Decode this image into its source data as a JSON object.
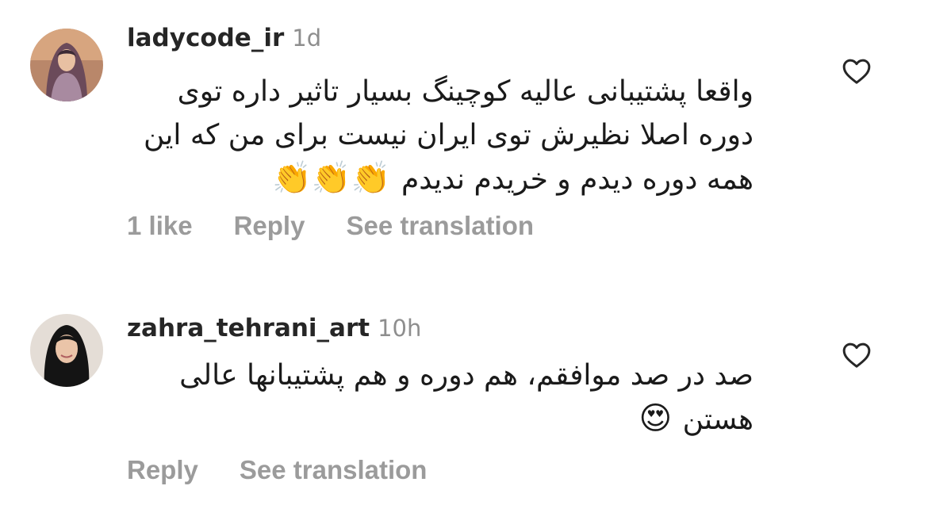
{
  "comments": [
    {
      "username": "ladycode_ir",
      "time": "1d",
      "text_lines": [
        "واقعا پشتیبانی عالیه کوچینگ بسیار تاثیر داره توی",
        "دوره  اصلا نظیرش توی ایران نیست برای من که این",
        "همه دوره دیدم و خریدم ندیدم"
      ],
      "emoji": "👏👏👏",
      "likes": "1 like",
      "reply": "Reply",
      "translate": "See translation",
      "avatar_icon": "woman-in-hijab-avatar",
      "heart_icon": "heart-outline-icon"
    },
    {
      "username": "zahra_tehrani_art",
      "time": "10h",
      "text_lines": [
        "صد در صد موافقم، هم دوره و هم پشتیبانها عالی",
        "هستن"
      ],
      "emoji": "😍",
      "reply": "Reply",
      "translate": "See translation",
      "avatar_icon": "woman-in-black-hijab-avatar",
      "heart_icon": "heart-outline-icon"
    }
  ]
}
